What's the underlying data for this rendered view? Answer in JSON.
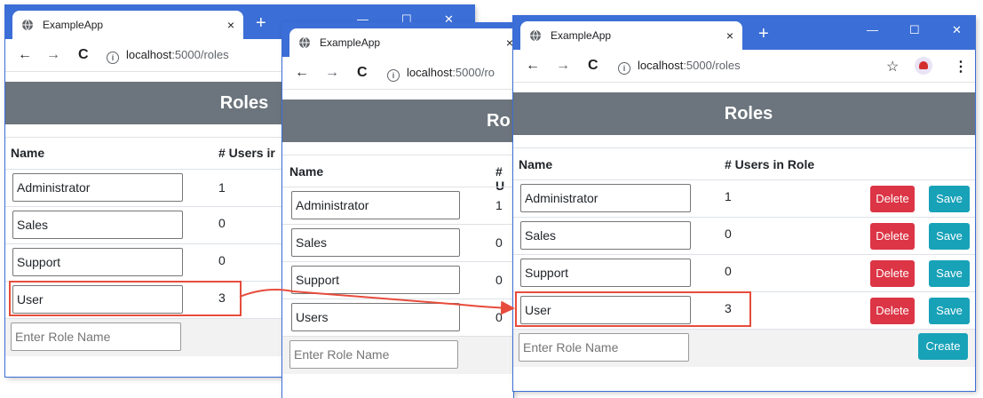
{
  "browser": {
    "tab_title": "ExampleApp",
    "tab_close": "×",
    "new_tab": "+",
    "url_host": "localhost",
    "url_path": ":5000/roles",
    "url_path_cut": ":5000/ro",
    "back_icon": "←",
    "forward_icon": "→",
    "reload_icon": "C",
    "info_icon": "i",
    "star_icon": "☆",
    "menu_icon": "⋮",
    "minimize": "—",
    "maximize": "☐",
    "close": "✕"
  },
  "page": {
    "title": "Roles",
    "title_cut": "Ro",
    "col_name": "Name",
    "col_users": "# Users in Role",
    "col_users_cut": "# Users ir",
    "col_users_cut2": "# U",
    "placeholder": "Enter Role Name",
    "delete_label": "Delete",
    "save_label": "Save",
    "create_label": "Create"
  },
  "win1_roles": [
    {
      "name": "Administrator",
      "count": "1"
    },
    {
      "name": "Sales",
      "count": "0"
    },
    {
      "name": "Support",
      "count": "0"
    },
    {
      "name": "User",
      "count": "3"
    }
  ],
  "win2_roles": [
    {
      "name": "Administrator",
      "count": "1"
    },
    {
      "name": "Sales",
      "count": "0"
    },
    {
      "name": "Support",
      "count": "0"
    },
    {
      "name": "Users",
      "count": "0"
    }
  ],
  "win3_roles": [
    {
      "name": "Administrator",
      "count": "1"
    },
    {
      "name": "Sales",
      "count": "0"
    },
    {
      "name": "Support",
      "count": "0"
    },
    {
      "name": "User",
      "count": "3"
    }
  ],
  "colors": {
    "titlebar": "#3b6ed6",
    "header": "#6c757d",
    "delete": "#dc3545",
    "save": "#17a2b8",
    "highlight": "#e74c3c"
  }
}
